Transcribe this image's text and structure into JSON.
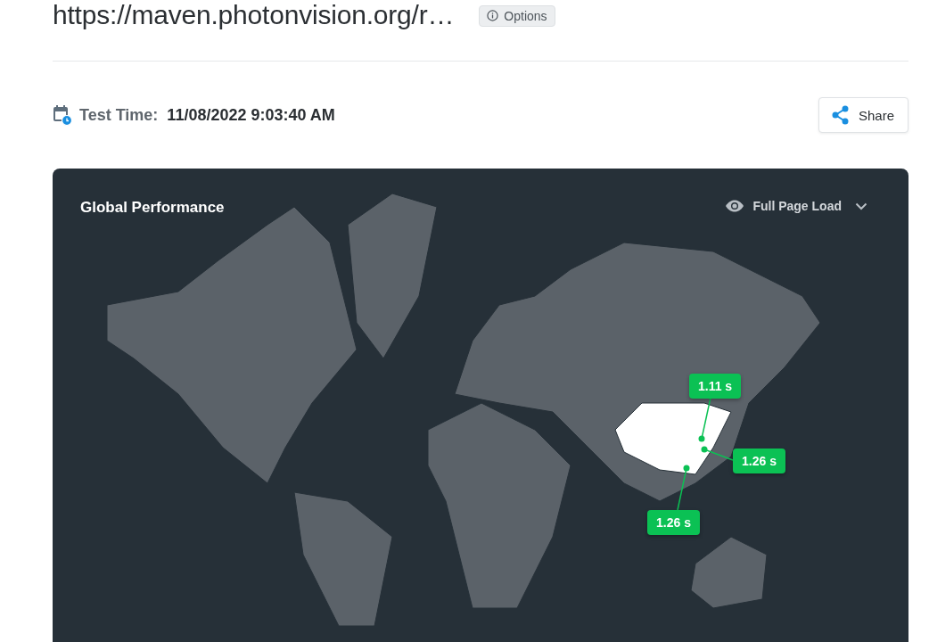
{
  "header": {
    "title": "https://maven.photonvision.org/r…",
    "options_label": "Options"
  },
  "test_time": {
    "label": "Test Time:",
    "value": "11/08/2022 9:03:40 AM"
  },
  "share_button": {
    "label": "Share"
  },
  "map_card": {
    "title": "Global Performance",
    "metric": "Full Page Load",
    "pins": [
      {
        "value": "1.11 s"
      },
      {
        "value": "1.26 s"
      },
      {
        "value": "1.26 s"
      }
    ]
  }
}
